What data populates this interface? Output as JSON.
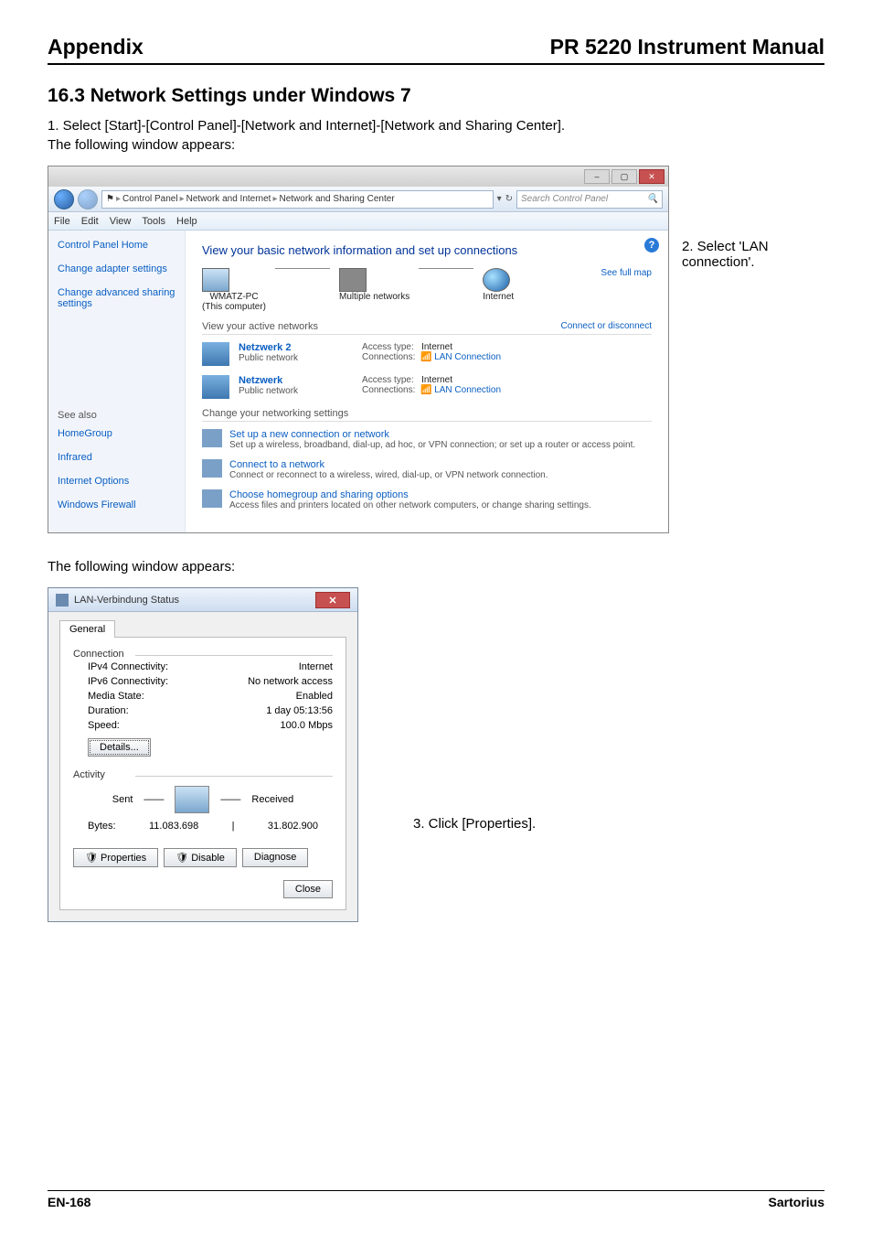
{
  "header": {
    "left": "Appendix",
    "right": "PR 5220 Instrument Manual"
  },
  "section": {
    "title": "16.3  Network Settings under Windows 7",
    "intro_step": "1.   Select [Start]-[Control Panel]-[Network and Internet]-[Network and Sharing Center].",
    "following1": "The following window appears:",
    "following2": "The following window appears:"
  },
  "step2": "2.   Select 'LAN connection'.",
  "step3": "3.   Click [Properties].",
  "footer": {
    "left": "EN-168",
    "right": "Sartorius"
  },
  "ss1": {
    "crumb": {
      "icon": "⚑",
      "p1": "Control Panel",
      "p2": "Network and Internet",
      "p3": "Network and Sharing Center"
    },
    "search_placeholder": "Search Control Panel",
    "menubar": [
      "File",
      "Edit",
      "View",
      "Tools",
      "Help"
    ],
    "sidebar": {
      "home": "Control Panel Home",
      "adapter": "Change adapter settings",
      "advanced1": "Change advanced sharing",
      "advanced2": "settings",
      "seealso": "See also",
      "links": [
        "HomeGroup",
        "Infrared",
        "Internet Options",
        "Windows Firewall"
      ]
    },
    "main": {
      "heading": "View your basic network information and set up connections",
      "map": {
        "pc": "WMATZ-PC",
        "pc_sub": "(This computer)",
        "mid": "Multiple networks",
        "net": "Internet",
        "fullmap": "See full map"
      },
      "active_title": "View your active networks",
      "active_right": "Connect or disconnect",
      "netblock1": {
        "title": "Netzwerk 2",
        "sub": "Public network",
        "access_lbl": "Access type:",
        "access_val": "Internet",
        "conn_lbl": "Connections:",
        "conn_val": "LAN Connection"
      },
      "netblock2": {
        "title": "Netzwerk",
        "sub": "Public network",
        "access_lbl": "Access type:",
        "access_val": "Internet",
        "conn_lbl": "Connections:",
        "conn_val": "LAN Connection"
      },
      "change_title": "Change your networking settings",
      "ci1": {
        "t": "Set up a new connection or network",
        "d": "Set up a wireless, broadband, dial-up, ad hoc, or VPN connection; or set up a router or access point."
      },
      "ci2": {
        "t": "Connect to a network",
        "d": "Connect or reconnect to a wireless, wired, dial-up, or VPN network connection."
      },
      "ci3": {
        "t": "Choose homegroup and sharing options",
        "d": "Access files and printers located on other network computers, or change sharing settings."
      }
    }
  },
  "ss2": {
    "title": "LAN-Verbindung Status",
    "tab": "General",
    "conn_group": "Connection",
    "rows": {
      "ipv4_l": "IPv4 Connectivity:",
      "ipv4_v": "Internet",
      "ipv6_l": "IPv6 Connectivity:",
      "ipv6_v": "No network access",
      "media_l": "Media State:",
      "media_v": "Enabled",
      "dur_l": "Duration:",
      "dur_v": "1 day 05:13:56",
      "speed_l": "Speed:",
      "speed_v": "100.0 Mbps"
    },
    "details_btn": "Details...",
    "activity_group": "Activity",
    "sent": "Sent",
    "dash": "——",
    "received": "Received",
    "bytes_lbl": "Bytes:",
    "bytes_sent": "11.083.698",
    "bytes_recv": "31.802.900",
    "btn_props": "Properties",
    "btn_disable": "Disable",
    "btn_diag": "Diagnose",
    "btn_close": "Close"
  }
}
